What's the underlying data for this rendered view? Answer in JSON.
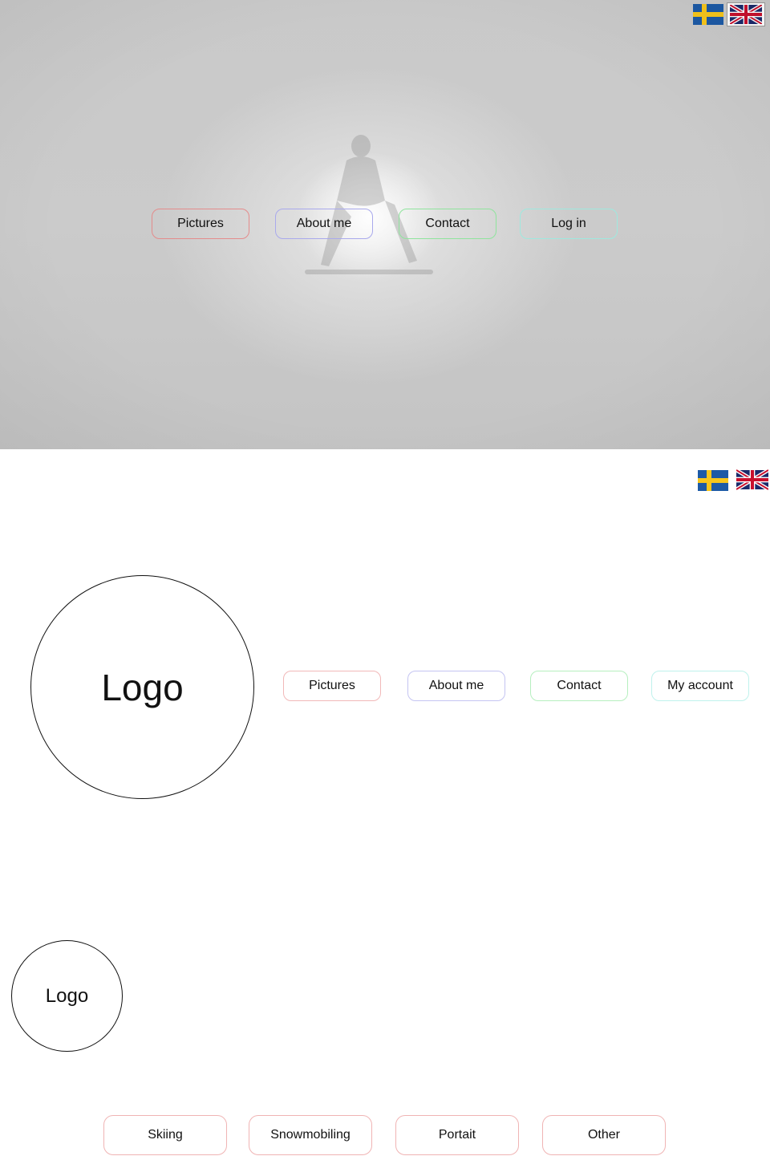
{
  "languages": [
    {
      "code": "sv",
      "icon": "swedish-flag-icon",
      "colors": {
        "blue": "#1d5aa6",
        "yellow": "#f7c61c"
      }
    },
    {
      "code": "en",
      "icon": "uk-flag-icon",
      "colors": {
        "blue": "#1b2a6b",
        "red": "#c8102e",
        "white": "#ffffff"
      }
    }
  ],
  "hero_nav": {
    "pictures": "Pictures",
    "about": "About me",
    "contact": "Contact",
    "login": "Log in"
  },
  "header_nav": {
    "pictures": "Pictures",
    "about": "About me",
    "contact": "Contact",
    "account": "My account"
  },
  "logo_large": {
    "label": "Logo"
  },
  "logo_small": {
    "label": "Logo"
  },
  "categories": {
    "skiing": "Skiing",
    "snowmobiling": "Snowmobiling",
    "portrait": "Portait",
    "other": "Other"
  },
  "accent_colors": {
    "pictures": "#e48c8c",
    "about": "#a9a9ec",
    "contact": "#8fe49d",
    "account": "#9ee9df",
    "categories": "#f0b4b4"
  }
}
